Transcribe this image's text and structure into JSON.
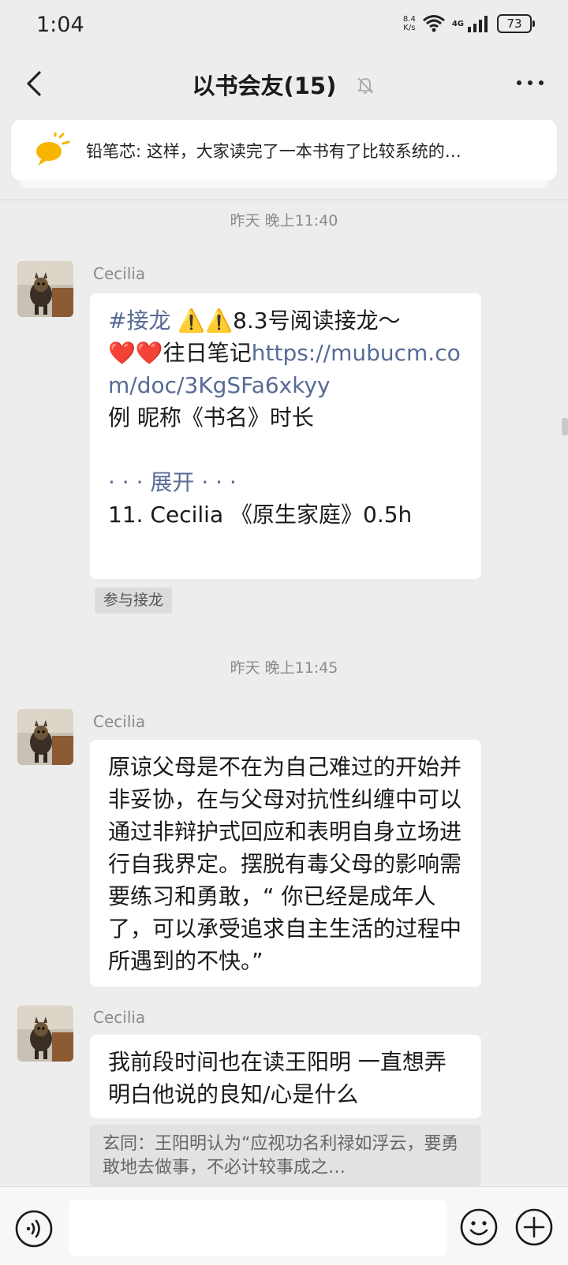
{
  "status": {
    "time": "1:04",
    "net_speed_value": "8.4",
    "net_speed_unit": "K/s",
    "network_type": "4G",
    "battery": "73"
  },
  "header": {
    "title": "以书会友(15)"
  },
  "pinned": {
    "text": "铅笔芯: 这样，大家读完了一本书有了比较系统的…"
  },
  "messages": [
    {
      "timestamp": "昨天 晚上11:40",
      "sender": "Cecilia",
      "hashtag": "#接龙",
      "line1_rest": " ⚠️⚠️8.3号阅读接龙～",
      "line2_prefix": "❤️❤️往日笔记",
      "link": "https://mubucm.com/doc/3KgSFa6xkyy",
      "line3": "例 昵称《书名》时长",
      "expand_label": "展开",
      "entry": "11. Cecilia 《原生家庭》0.5h",
      "join_label": "参与接龙"
    },
    {
      "timestamp": "昨天 晚上11:45",
      "sender": "Cecilia",
      "text": "原谅父母是不在为自己难过的开始并非妥协，在与父母对抗性纠缠中可以通过非辩护式回应和表明自身立场进行自我界定。摆脱有毒父母的影响需要练习和勇敢，“ 你已经是成年人了，可以承受追求自主生活的过程中所遇到的不快。”"
    },
    {
      "sender": "Cecilia",
      "text": "我前段时间也在读王阳明 一直想弄明白他说的良知/心是什么",
      "quote": "玄同：王阳明认为“应视功名利禄如浮云，要勇敢地去做事，不必计较事成之…"
    }
  ],
  "input_bar": {
    "placeholder": ""
  },
  "colors": {
    "background": "#ededed",
    "link": "#576b95",
    "bubble": "#ffffff",
    "timestamp": "#8a8a8a"
  },
  "icons": [
    "back-icon",
    "mute-bell-icon",
    "more-icon",
    "announcement-icon",
    "voice-icon",
    "emoji-icon",
    "plus-icon"
  ]
}
